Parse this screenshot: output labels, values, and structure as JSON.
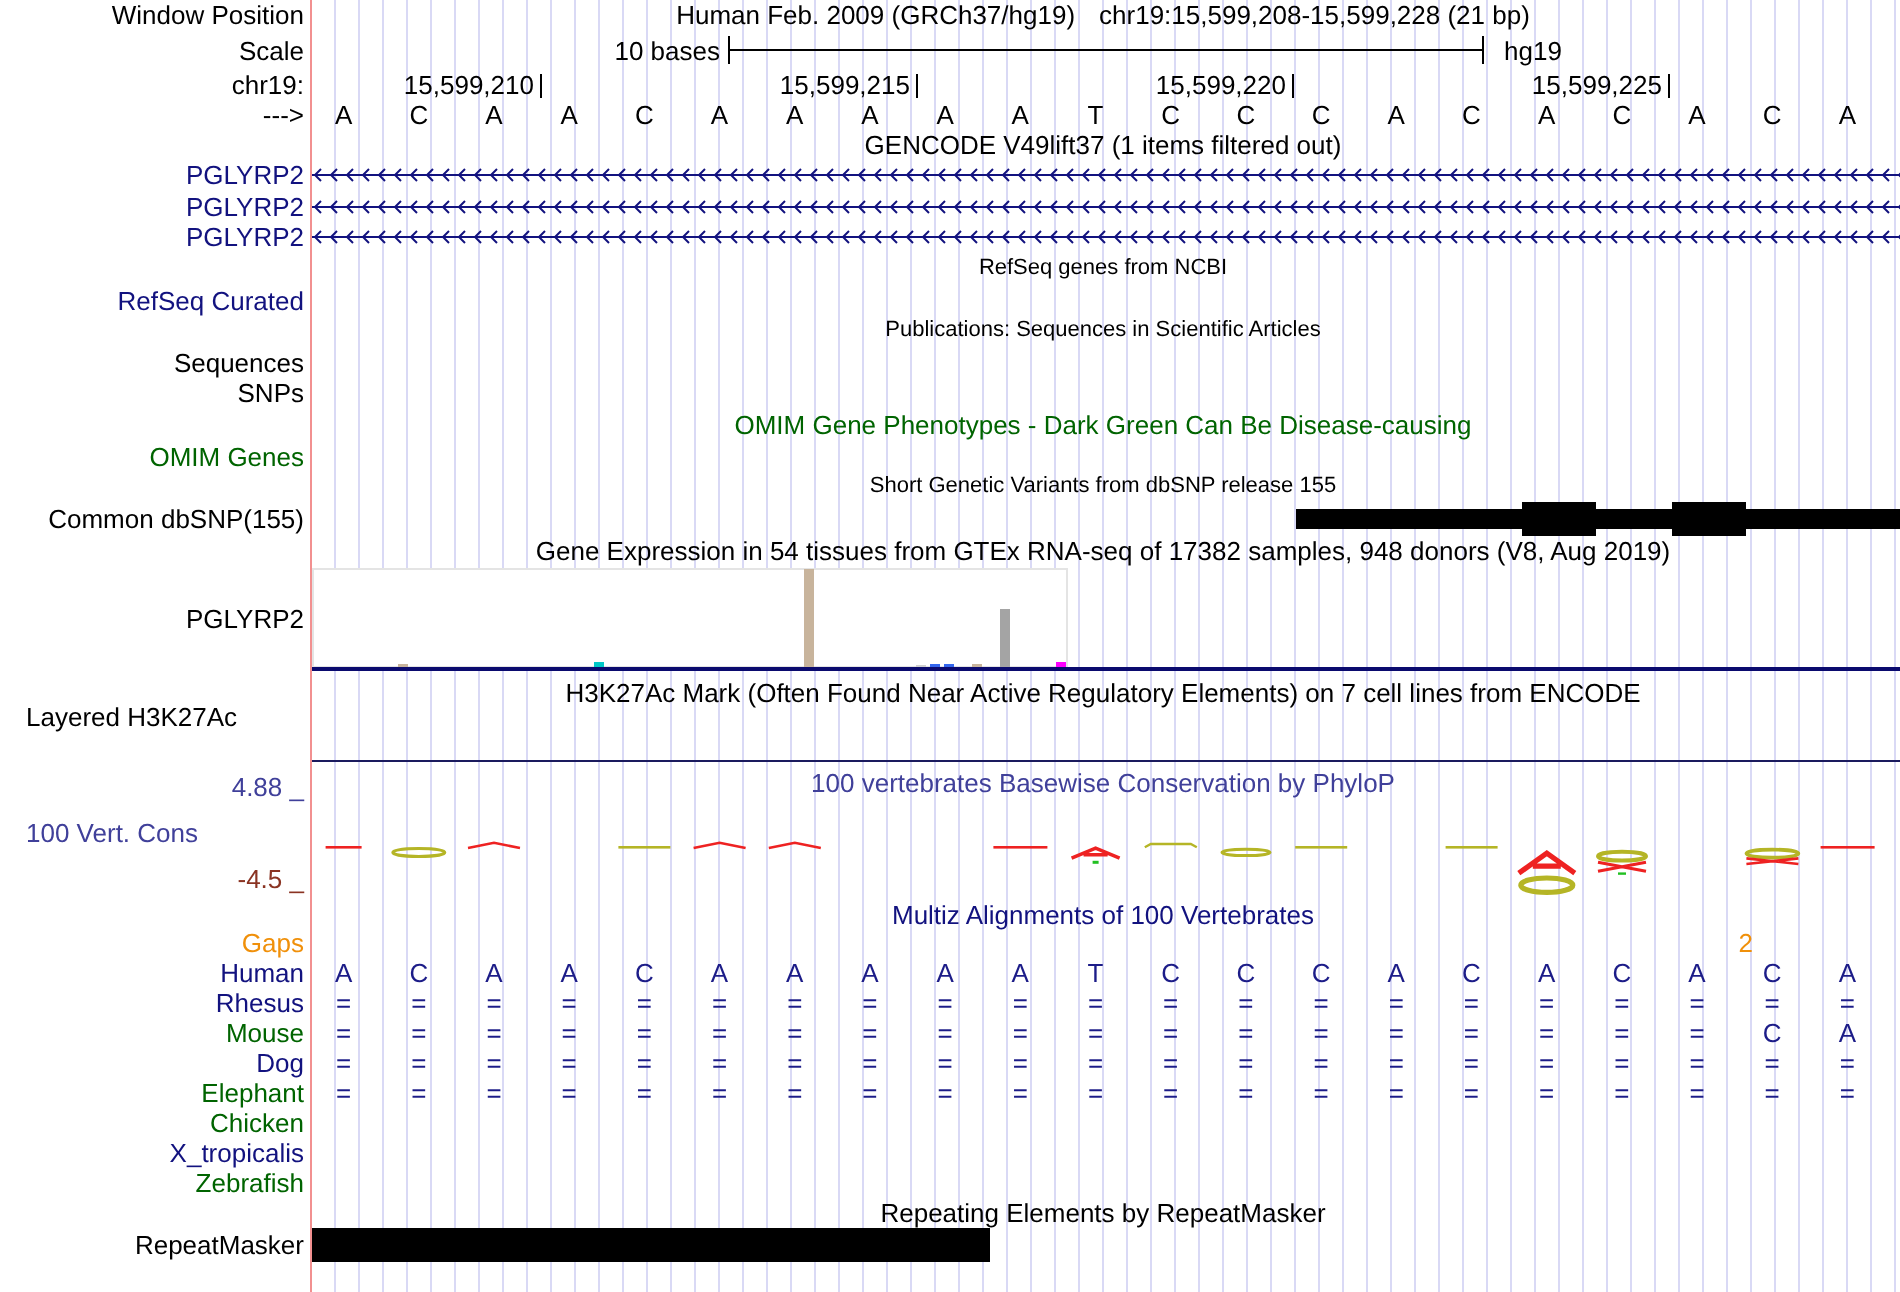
{
  "header": [
    {
      "kind": "position",
      "label": "Window Position",
      "assembly": "Human Feb. 2009 (GRCh37/hg19)",
      "range": "chr19:15,599,208-15,599,228 (21 bp)"
    },
    {
      "kind": "scale",
      "label": "Scale",
      "length": "10 bases",
      "assembly": "hg19"
    },
    {
      "kind": "ruler",
      "label": "chr19:",
      "ticks": [
        "15,599,210",
        "15,599,215",
        "15,599,220",
        "15,599,225"
      ]
    },
    {
      "kind": "sequence",
      "label": "--->",
      "bases": [
        "A",
        "C",
        "A",
        "A",
        "C",
        "A",
        "A",
        "A",
        "A",
        "A",
        "T",
        "C",
        "C",
        "C",
        "A",
        "C",
        "A",
        "C",
        "A",
        "C",
        "A"
      ]
    }
  ],
  "tracks": [
    {
      "kind": "genes",
      "title": {
        "text": "GENCODE V49lift37 (1 items filtered out)",
        "color": "#000000"
      },
      "rows": [
        {
          "label": {
            "text": "PGLYRP2",
            "color": "#12127f"
          },
          "reverse": true
        },
        {
          "label": {
            "text": "PGLYRP2",
            "color": "#12127f"
          },
          "reverse": true
        },
        {
          "label": {
            "text": "PGLYRP2",
            "color": "#12127f"
          },
          "reverse": true
        }
      ]
    },
    {
      "kind": "refseq",
      "title": {
        "text": "RefSeq genes from NCBI",
        "color": "#000000"
      },
      "rows": [
        {
          "label": {
            "text": "RefSeq Curated",
            "color": "#12127f"
          }
        }
      ]
    },
    {
      "kind": "publications",
      "title": {
        "text": "Publications: Sequences in Scientific Articles",
        "color": "#000000"
      },
      "rows": [
        {
          "label": {
            "text": "Sequences",
            "color": "#000000"
          }
        },
        {
          "label": {
            "text": "SNPs",
            "color": "#000000"
          }
        }
      ]
    },
    {
      "kind": "omim",
      "title": {
        "text": "OMIM Gene Phenotypes - Dark Green Can Be Disease-causing",
        "color": "#006400"
      },
      "rows": [
        {
          "label": {
            "text": "OMIM Genes",
            "color": "#006400"
          }
        }
      ]
    },
    {
      "kind": "snps",
      "title": {
        "text": "Short Genetic Variants from dbSNP release 155",
        "color": "#000000"
      },
      "rows": [
        {
          "label": {
            "text": "Common dbSNP(155)",
            "color": "#000000"
          }
        }
      ]
    },
    {
      "kind": "expression",
      "title": {
        "text": "Gene Expression in 54 tissues from GTEx RNA-seq of 17382 samples, 948 donors (V8, Aug 2019)",
        "color": "#000000"
      },
      "rows": [
        {
          "label": {
            "text": "PGLYRP2",
            "color": "#000000"
          }
        }
      ]
    },
    {
      "kind": "signal",
      "title": {
        "text": "H3K27Ac Mark (Often Found Near Active Regulatory Elements) on 7 cell lines from ENCODE",
        "color": "#000000"
      },
      "rows": [
        {
          "label": {
            "text": "Layered H3K27Ac",
            "color": "#000000"
          }
        }
      ]
    },
    {
      "kind": "conservation",
      "title": {
        "text": "100 vertebrates Basewise Conservation by PhyloP",
        "color": "#40409a"
      },
      "axis": {
        "top": {
          "text": "4.88 _",
          "color": "#40409a"
        },
        "bottom": {
          "text": "-4.5 _",
          "color": "#8a3322"
        }
      },
      "rows": [
        {
          "label": {
            "text": "100 Vert. Cons",
            "color": "#40409a"
          }
        }
      ]
    },
    {
      "kind": "alignment",
      "title": {
        "text": "Multiz Alignments of 100 Vertebrates",
        "color": "#12127f"
      },
      "gaps": {
        "label": {
          "text": "Gaps",
          "color": "#f0900a"
        },
        "columns": [
          {},
          {},
          {},
          {},
          {},
          {},
          {},
          {},
          {},
          {},
          {},
          {},
          {},
          {},
          {},
          {},
          {},
          {},
          {},
          {
            "count": "2"
          },
          {}
        ]
      },
      "rows": [
        {
          "label": {
            "text": "Human",
            "color": "#12127f"
          },
          "bases": [
            "A",
            "C",
            "A",
            "A",
            "C",
            "A",
            "A",
            "A",
            "A",
            "A",
            "T",
            "C",
            "C",
            "C",
            "A",
            "C",
            "A",
            "C",
            "A",
            "C",
            "A"
          ]
        },
        {
          "label": {
            "text": "Rhesus",
            "color": "#12127f"
          },
          "bases": [
            "=",
            "=",
            "=",
            "=",
            "=",
            "=",
            "=",
            "=",
            "=",
            "=",
            "=",
            "=",
            "=",
            "=",
            "=",
            "=",
            "=",
            "=",
            "=",
            "=",
            "="
          ]
        },
        {
          "label": {
            "text": "Mouse",
            "color": "#006400"
          },
          "bases": [
            "=",
            "=",
            "=",
            "=",
            "=",
            "=",
            "=",
            "=",
            "=",
            "=",
            "=",
            "=",
            "=",
            "=",
            "=",
            "=",
            "=",
            "=",
            "=",
            "C",
            "A"
          ]
        },
        {
          "label": {
            "text": "Dog",
            "color": "#12127f"
          },
          "bases": [
            "=",
            "=",
            "=",
            "=",
            "=",
            "=",
            "=",
            "=",
            "=",
            "=",
            "=",
            "=",
            "=",
            "=",
            "=",
            "=",
            "=",
            "=",
            "=",
            "=",
            "="
          ]
        },
        {
          "label": {
            "text": "Elephant",
            "color": "#006400"
          },
          "bases": [
            "=",
            "=",
            "=",
            "=",
            "=",
            "=",
            "=",
            "=",
            "=",
            "=",
            "=",
            "=",
            "=",
            "=",
            "=",
            "=",
            "=",
            "=",
            "=",
            "=",
            "="
          ]
        },
        {
          "label": {
            "text": "Chicken",
            "color": "#006400"
          }
        },
        {
          "label": {
            "text": "X_tropicalis",
            "color": "#12127f"
          }
        },
        {
          "label": {
            "text": "Zebrafish",
            "color": "#006400"
          }
        }
      ]
    },
    {
      "kind": "repeats",
      "title": {
        "text": "Repeating Elements by RepeatMasker",
        "color": "#000000"
      },
      "rows": [
        {
          "label": {
            "text": "RepeatMasker",
            "color": "#000000"
          }
        }
      ]
    }
  ]
}
